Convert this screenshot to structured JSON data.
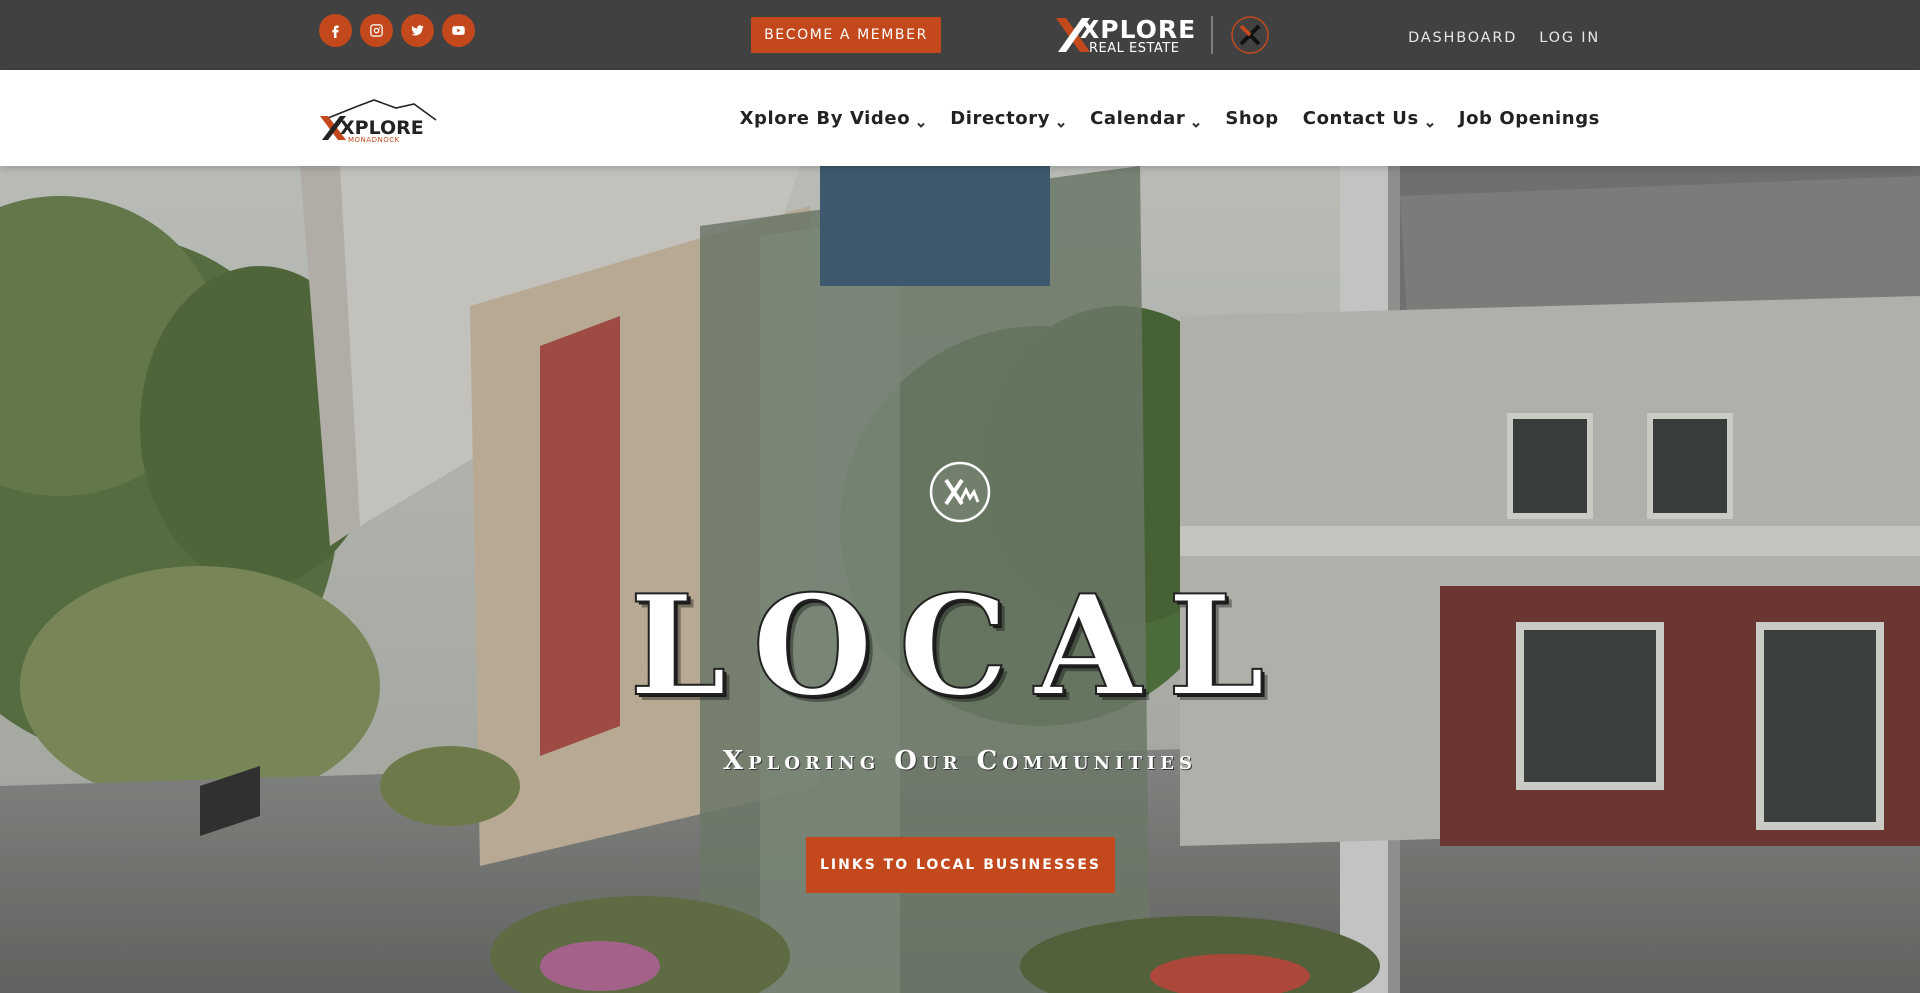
{
  "topbar": {
    "social": [
      {
        "name": "facebook-icon"
      },
      {
        "name": "instagram-icon"
      },
      {
        "name": "twitter-icon"
      },
      {
        "name": "youtube-icon"
      }
    ],
    "member_button": "BECOME A MEMBER",
    "brand_logo": {
      "line1": "XPLORE",
      "line2": "REAL ESTATE"
    },
    "links": {
      "dashboard": "DASHBOARD",
      "login": "LOG IN"
    }
  },
  "nav": {
    "logo": {
      "word": "XPLORE",
      "tagline": "MONADNOCK"
    },
    "items": [
      {
        "label": "Xplore By Video",
        "dropdown": true
      },
      {
        "label": "Directory",
        "dropdown": true
      },
      {
        "label": "Calendar",
        "dropdown": true
      },
      {
        "label": "Shop",
        "dropdown": false
      },
      {
        "label": "Contact Us",
        "dropdown": true
      },
      {
        "label": "Job Openings",
        "dropdown": false
      }
    ]
  },
  "hero": {
    "title": "LOCAL",
    "subtitle": "Xploring Our Communities",
    "cta": "LINKS TO LOCAL BUSINESSES"
  },
  "colors": {
    "accent": "#c3491c",
    "topbar": "#414141",
    "nav_bg": "#ffffff"
  }
}
